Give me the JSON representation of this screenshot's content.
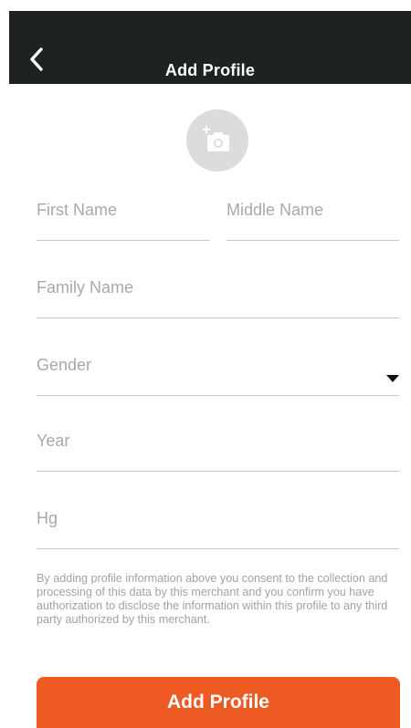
{
  "header": {
    "title": "Add Profile",
    "back_icon": "chevron-left-icon"
  },
  "photo": {
    "icon": "add-photo-camera-icon"
  },
  "form": {
    "first_name_placeholder": "First Name",
    "middle_name_placeholder": "Middle Name",
    "family_name_placeholder": "Family Name",
    "gender_placeholder": "Gender",
    "year_placeholder": "Year",
    "hg_placeholder": "Hg"
  },
  "consent_text": "By adding profile information above you consent to the collection and processing of this data by this merchant and you confirm you have authorization to disclose the information within this profile to any third party authorized by this merchant.",
  "submit_label": "Add Profile",
  "colors": {
    "header_bg": "#1e231f",
    "accent": "#ee5a23",
    "placeholder": "#a9a9a9"
  }
}
